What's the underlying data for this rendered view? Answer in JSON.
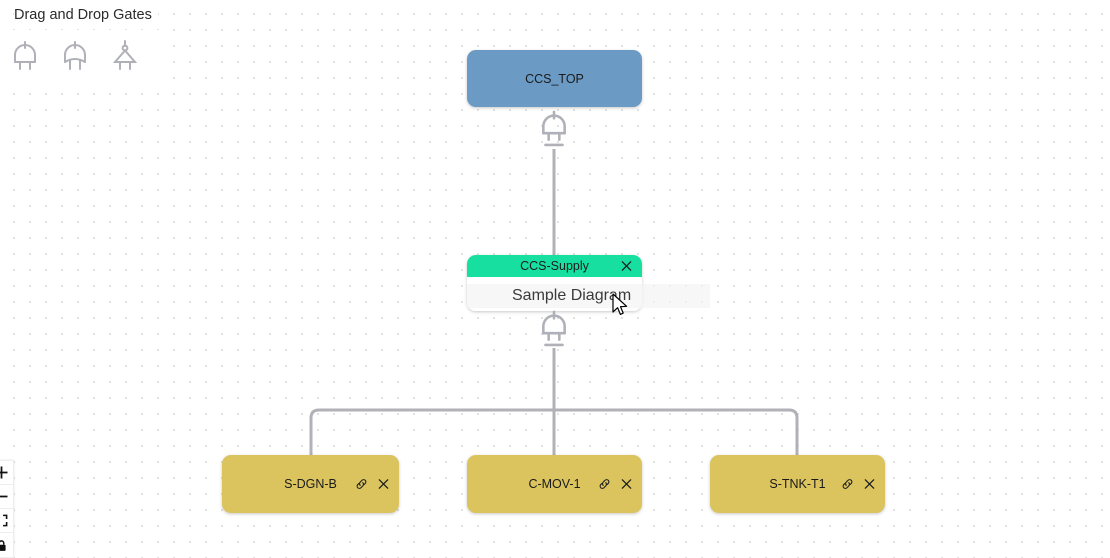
{
  "palette": {
    "title": "Drag and Drop Gates",
    "gates": [
      {
        "name": "and-gate",
        "label": "AND"
      },
      {
        "name": "or-gate",
        "label": "OR"
      },
      {
        "name": "vote-gate",
        "label": "VOTE"
      }
    ]
  },
  "overlay": {
    "text": "Sample Diagram"
  },
  "colors": {
    "top_node": "#6b9ac4",
    "intermediate_node_header": "#16dfa0",
    "basic_event_node": "#dbc45e",
    "edge": "#b1b1b7",
    "gate_symbol": "#b0b0b8"
  },
  "nodes": {
    "top": {
      "label": "CCS_TOP",
      "type": "top-event"
    },
    "intermediate": {
      "label": "CCS-Supply",
      "type": "intermediate-event",
      "close_icon": "close-icon"
    },
    "basic": [
      {
        "label": "S-DGN-B",
        "link_icon": "link-icon",
        "close_icon": "close-icon"
      },
      {
        "label": "C-MOV-1",
        "link_icon": "link-icon",
        "close_icon": "close-icon"
      },
      {
        "label": "S-TNK-T1",
        "link_icon": "link-icon",
        "close_icon": "close-icon"
      }
    ]
  },
  "canvas_gates": [
    {
      "name": "and-gate-top",
      "type": "AND"
    },
    {
      "name": "and-gate-mid",
      "type": "AND"
    }
  ],
  "controls": [
    {
      "name": "zoom-in-button",
      "icon": "plus-icon"
    },
    {
      "name": "zoom-out-button",
      "icon": "minus-icon"
    },
    {
      "name": "fit-view-button",
      "icon": "fit-view-icon"
    },
    {
      "name": "lock-button",
      "icon": "lock-icon"
    }
  ]
}
